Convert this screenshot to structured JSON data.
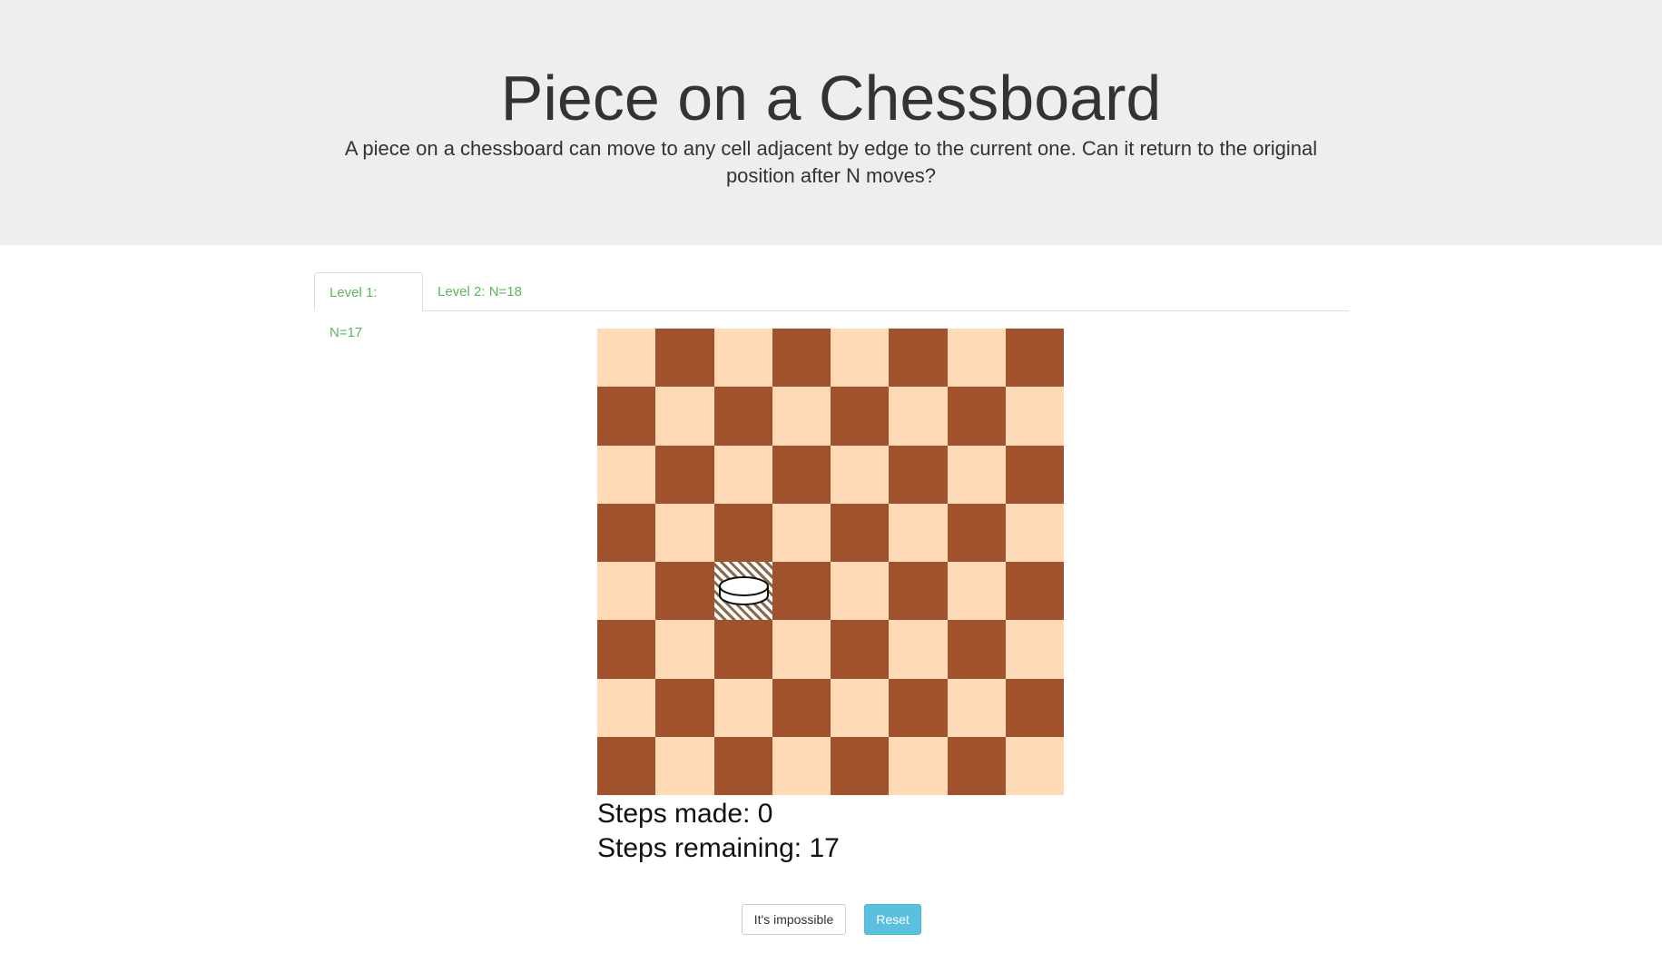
{
  "header": {
    "title": "Piece on a Chessboard",
    "description": "A piece on a chessboard can move to any cell adjacent by edge to the current one. Can it return to the original position after N moves?"
  },
  "tabs": [
    {
      "label": "Level 1: N=17",
      "active": true
    },
    {
      "label": "Level 2: N=18",
      "active": false
    }
  ],
  "board": {
    "rows": 8,
    "cols": 8,
    "light_color": "#ffdab6",
    "dark_color": "#a0522d",
    "piece": {
      "row": 5,
      "col": 3
    }
  },
  "stats": {
    "steps_made": "Steps made: 0",
    "steps_remaining": "Steps remaining: 17"
  },
  "buttons": {
    "impossible_label": "It's impossible",
    "reset_label": "Reset"
  },
  "colors": {
    "tab_text": "#5cb85c",
    "reset_button": "#5bc0de",
    "header_bg": "#eeeeee"
  }
}
